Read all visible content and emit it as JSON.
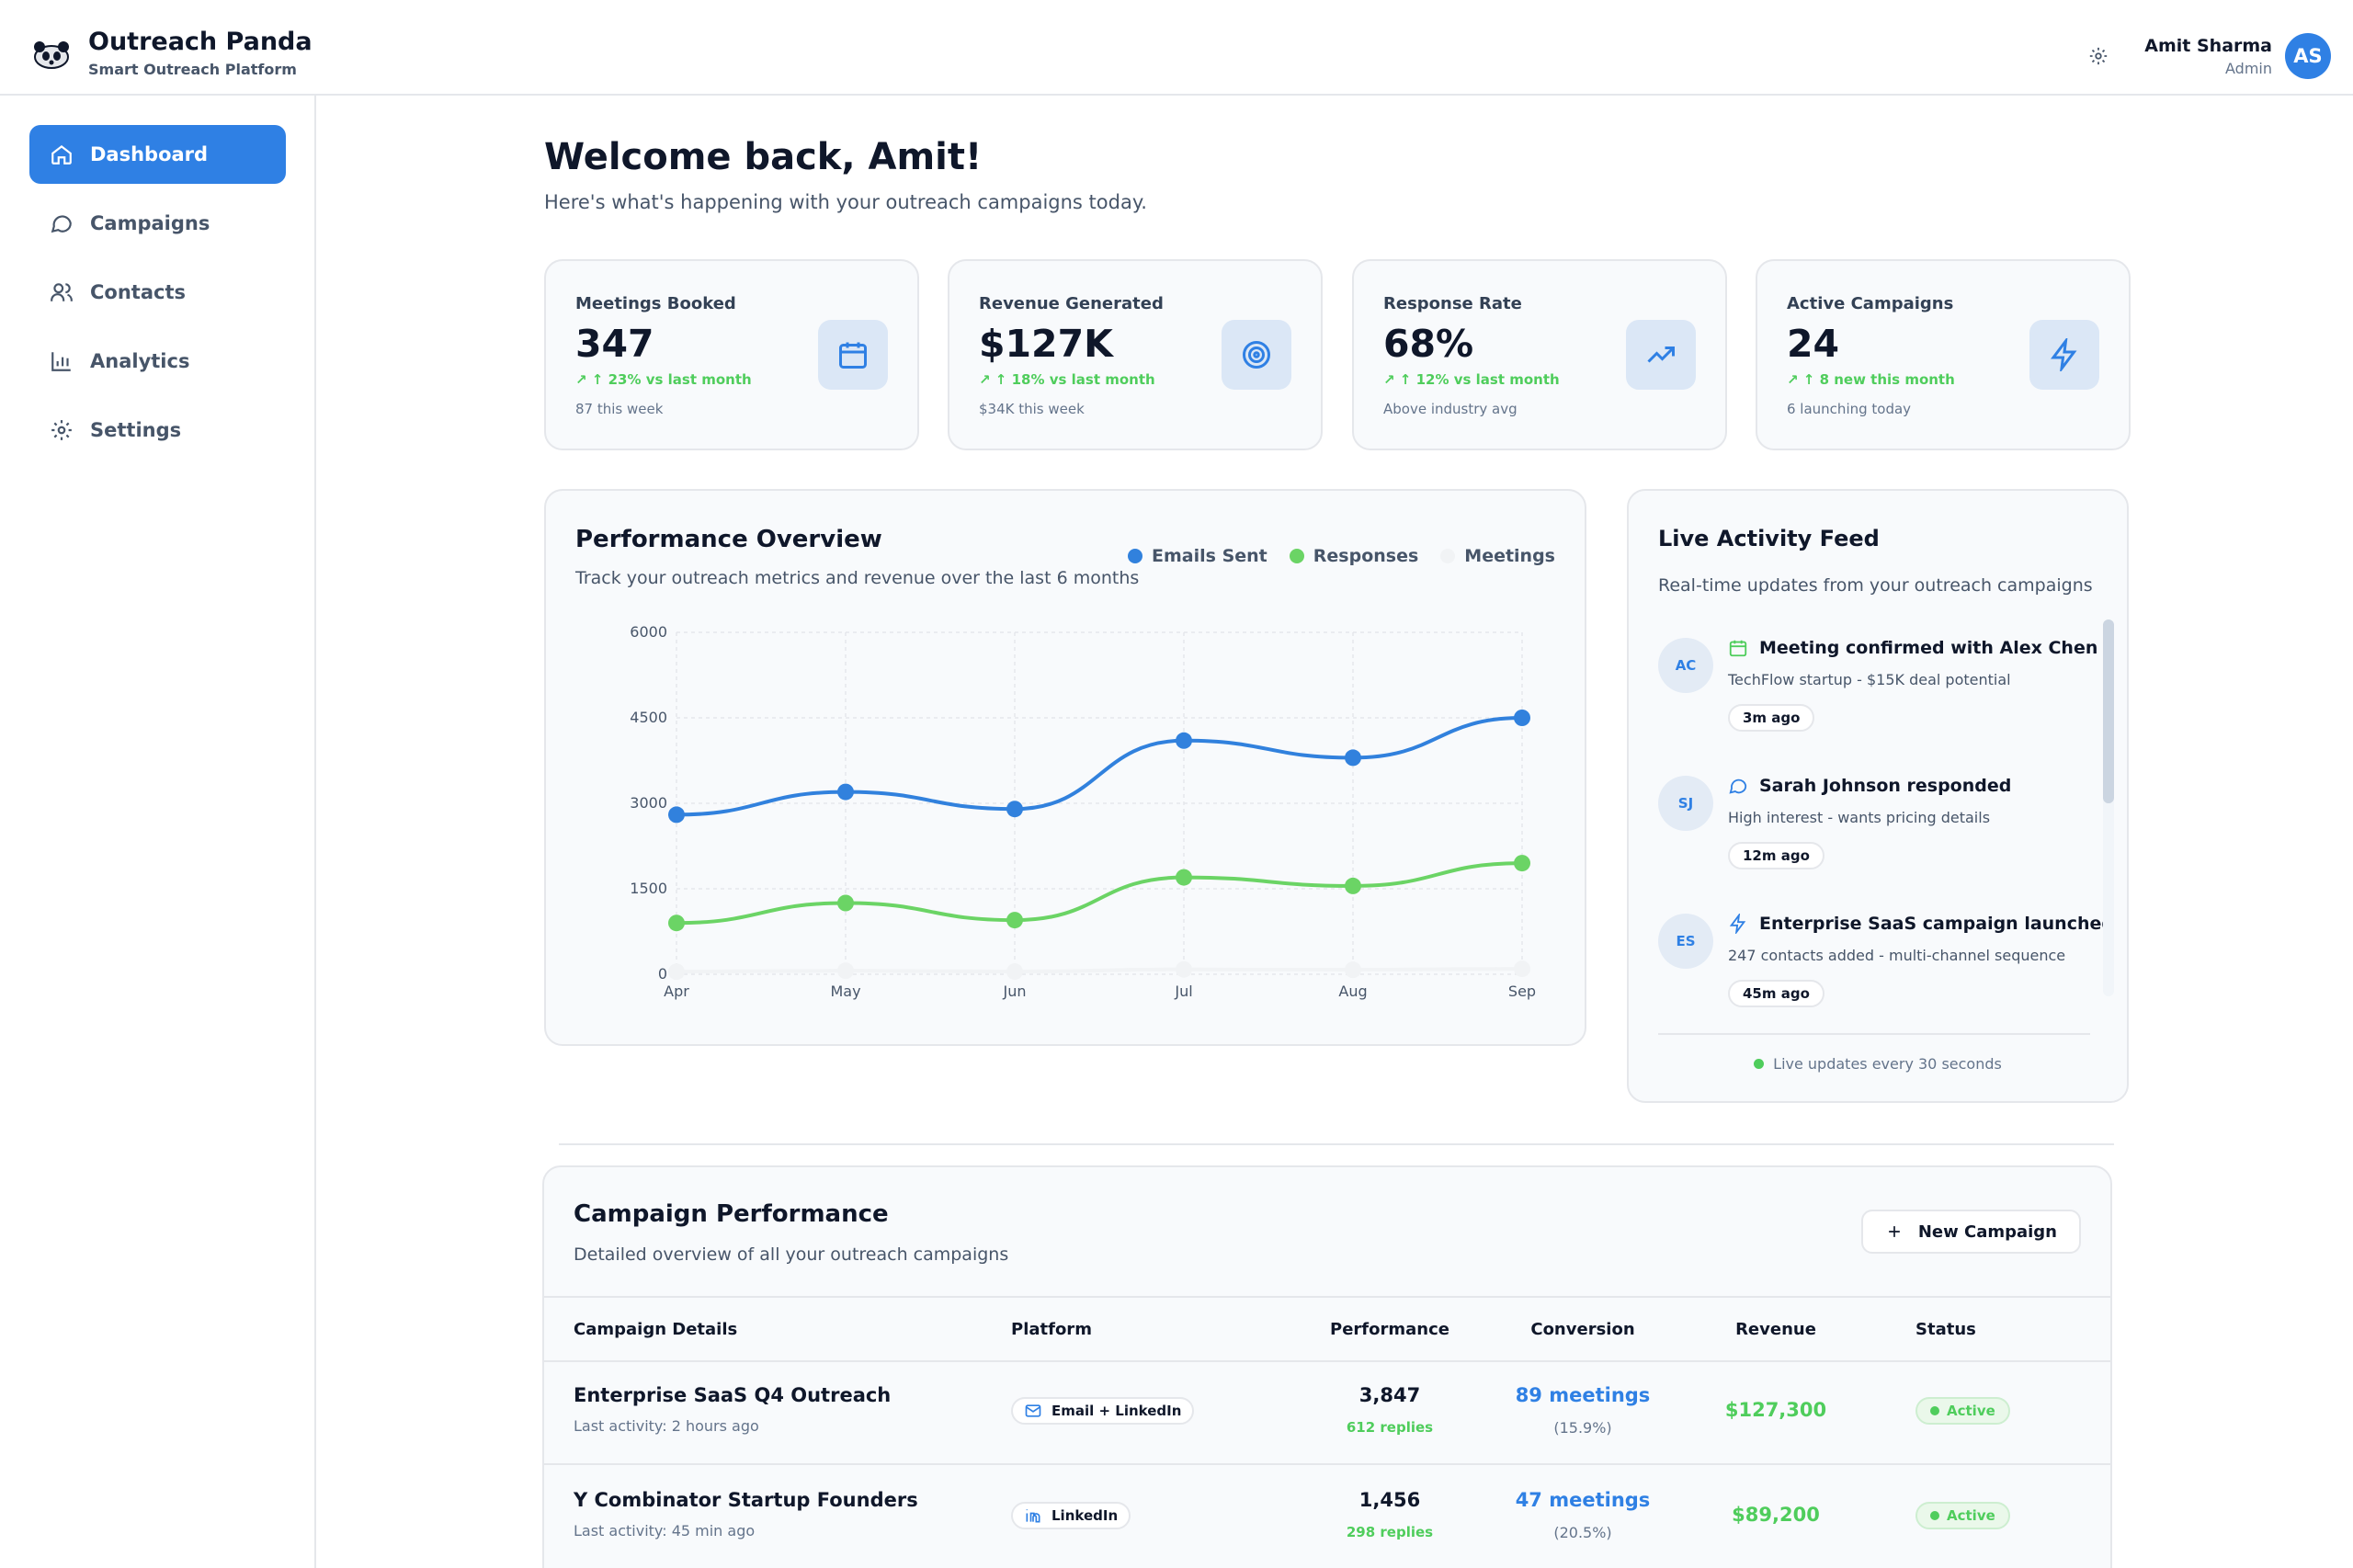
{
  "brand": {
    "title": "Outreach Panda",
    "subtitle": "Smart Outreach Platform"
  },
  "user": {
    "name": "Amit Sharma",
    "role": "Admin",
    "initials": "AS"
  },
  "sidebar": {
    "items": [
      {
        "label": "Dashboard",
        "icon": "home-icon",
        "active": true
      },
      {
        "label": "Campaigns",
        "icon": "chat-icon",
        "active": false
      },
      {
        "label": "Contacts",
        "icon": "users-icon",
        "active": false
      },
      {
        "label": "Analytics",
        "icon": "bar-chart-icon",
        "active": false
      },
      {
        "label": "Settings",
        "icon": "gear-icon",
        "active": false
      }
    ]
  },
  "welcome": {
    "title": "Welcome back, Amit!",
    "subtitle": "Here's what's happening with your outreach campaigns today."
  },
  "stats": [
    {
      "label": "Meetings Booked",
      "value": "347",
      "trend": "↗ ↑ 23% vs last month",
      "note": "87 this week",
      "icon": "calendar-icon"
    },
    {
      "label": "Revenue Generated",
      "value": "$127K",
      "trend": "↗ ↑ 18% vs last month",
      "note": "$34K this week",
      "icon": "target-icon"
    },
    {
      "label": "Response Rate",
      "value": "68%",
      "trend": "↗ ↑ 12% vs last month",
      "note": "Above industry avg",
      "icon": "trending-up-icon"
    },
    {
      "label": "Active Campaigns",
      "value": "24",
      "trend": "↗ ↑ 8 new this month",
      "note": "6 launching today",
      "icon": "lightning-icon"
    }
  ],
  "performance": {
    "title": "Performance Overview",
    "subtitle": "Track your outreach metrics and revenue over the last 6 months"
  },
  "chart_data": {
    "type": "line",
    "x": [
      "Apr",
      "May",
      "Jun",
      "Jul",
      "Aug",
      "Sep"
    ],
    "series": [
      {
        "name": "Emails Sent",
        "color": "#3181dd",
        "values": [
          2800,
          3200,
          2900,
          4100,
          3800,
          4500
        ]
      },
      {
        "name": "Responses",
        "color": "#6bd465",
        "values": [
          900,
          1250,
          950,
          1700,
          1550,
          1950
        ]
      },
      {
        "name": "Meetings",
        "color": "#f1f3f5",
        "values": [
          45,
          62,
          48,
          85,
          78,
          95
        ]
      }
    ],
    "ylim": [
      0,
      6000
    ],
    "yticks": [
      0,
      1500,
      3000,
      4500,
      6000
    ],
    "grid": true,
    "legend": "top-right"
  },
  "feed": {
    "title": "Live Activity Feed",
    "subtitle": "Real-time updates from your outreach campaigns",
    "items": [
      {
        "initials": "AC",
        "icon": "calendar-icon",
        "title": "Meeting confirmed with Alex Chen",
        "desc": "TechFlow startup - $15K deal potential",
        "time": "3m ago"
      },
      {
        "initials": "SJ",
        "icon": "chat-icon",
        "title": "Sarah Johnson responded",
        "desc": "High interest - wants pricing details",
        "time": "12m ago"
      },
      {
        "initials": "ES",
        "icon": "lightning-icon",
        "title": "Enterprise SaaS campaign launched",
        "desc": "247 contacts added - multi-channel sequence",
        "time": "45m ago"
      }
    ],
    "live_text": "Live updates every 30 seconds"
  },
  "campaigns": {
    "title": "Campaign Performance",
    "subtitle": "Detailed overview of all your outreach campaigns",
    "new_button": "New Campaign",
    "columns": [
      "Campaign Details",
      "Platform",
      "Performance",
      "Conversion",
      "Revenue",
      "Status"
    ],
    "rows": [
      {
        "name": "Enterprise SaaS Q4 Outreach",
        "activity": "Last activity: 2 hours ago",
        "platform": "Email + LinkedIn",
        "platform_icon": "mail-icon",
        "sent": "3,847",
        "replies": "612 replies",
        "meetings": "89 meetings",
        "rate": "(15.9%)",
        "revenue": "$127,300",
        "status": "Active"
      },
      {
        "name": "Y Combinator Startup Founders",
        "activity": "Last activity: 45 min ago",
        "platform": "LinkedIn",
        "platform_icon": "linkedin-icon",
        "sent": "1,456",
        "replies": "298 replies",
        "meetings": "47 meetings",
        "rate": "(20.5%)",
        "revenue": "$89,200",
        "status": "Active"
      }
    ]
  }
}
